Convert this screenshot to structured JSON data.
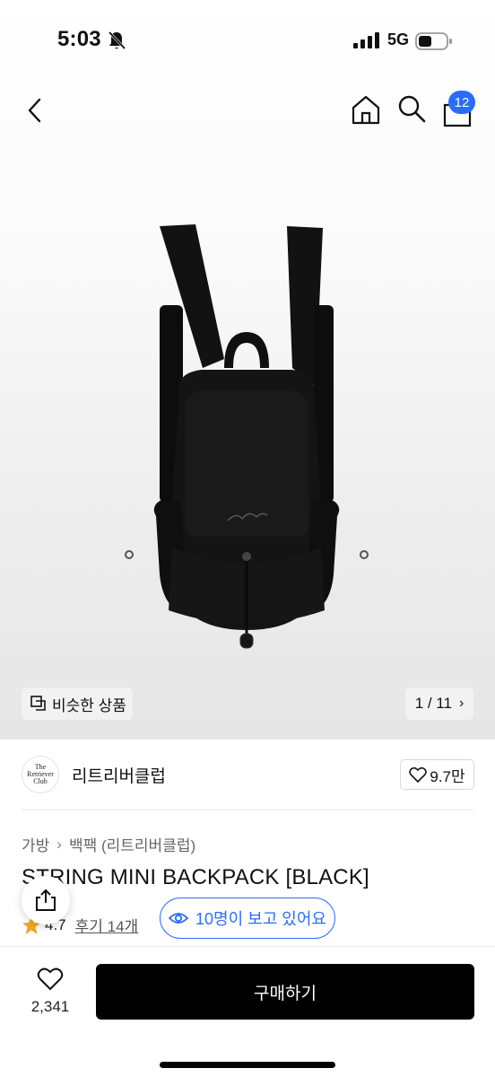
{
  "status_bar": {
    "time": "5:03",
    "network": "5G"
  },
  "nav": {
    "cart_badge": "12",
    "icons": [
      "back-arrow-icon",
      "home-icon",
      "search-icon",
      "shopping-bag-icon"
    ]
  },
  "gallery": {
    "similar_label": "비슷한 상품",
    "counter": "1 / 11"
  },
  "brand": {
    "logo_text_1": "The",
    "logo_text_2": "Retriever",
    "logo_text_3": "Club",
    "name": "리트리버클럽",
    "likes": "9.7만"
  },
  "breadcrumb": {
    "category": "가방",
    "subcategory": "백팩 (리트리버클럽)"
  },
  "product": {
    "title": "STRING MINI BACKPACK [BLACK]",
    "rating": "4.7",
    "reviews": "후기 14개",
    "viewers": "10명이 보고 있어요"
  },
  "bottom_bar": {
    "wish_count": "2,341",
    "buy_label": "구매하기"
  },
  "colors": {
    "accent": "#2b6cff",
    "primary_button": "#000000",
    "star": "#f5a623"
  }
}
